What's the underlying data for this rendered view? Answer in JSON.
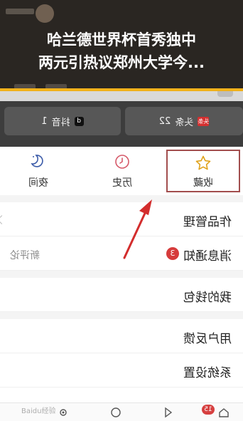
{
  "banner": {
    "line1": "哈兰德世界杯首秀独中",
    "line2": "两元引热议郑州大学今...",
    "accent": "#f2b21a"
  },
  "header": {
    "pills": [
      {
        "label": "头条",
        "count": "22",
        "badge": "头条"
      },
      {
        "label": "抖音",
        "count": "1",
        "badge": "d"
      }
    ]
  },
  "quick_actions": [
    {
      "label": "收藏",
      "icon": "star-icon"
    },
    {
      "label": "历史",
      "icon": "history-icon"
    },
    {
      "label": "夜间",
      "icon": "moon-icon"
    }
  ],
  "menu": [
    {
      "label": "作品管理"
    },
    {
      "label": "消息通知",
      "badge": "3",
      "right": "新评论"
    },
    {
      "label": "我的钱包"
    },
    {
      "label": "用户反馈"
    },
    {
      "label": "系统设置"
    }
  ],
  "bottom_nav": {
    "badge": "15"
  }
}
